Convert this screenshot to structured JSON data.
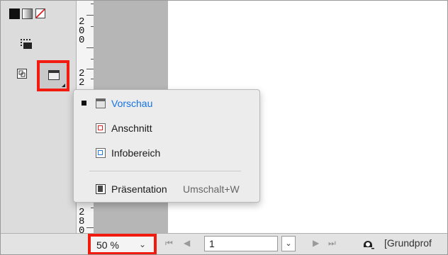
{
  "toolbar": {
    "fill_swatch_icon": "fill-black-swatch",
    "gradient_icon": "gradient-swatch",
    "none_icon": "none-swatch",
    "frame_tool_icon": "dotted-frame-tool",
    "normal_mode_icon": "normal-view-mode",
    "screen_mode_icon": "preview-screen-mode"
  },
  "ruler": {
    "labels": [
      "2",
      "0",
      "0",
      "2",
      "2",
      "2",
      "8",
      "0"
    ]
  },
  "menu": {
    "items": [
      {
        "label": "Vorschau",
        "shortcut": "",
        "checked": true,
        "icon": "vorschau-mode-icon",
        "color": "#1473e6"
      },
      {
        "label": "Anschnitt",
        "shortcut": "",
        "checked": false,
        "icon": "anschnitt-mode-icon",
        "color": "#1a1a1a"
      },
      {
        "label": "Infobereich",
        "shortcut": "",
        "checked": false,
        "icon": "infobereich-mode-icon",
        "color": "#1a1a1a"
      },
      {
        "label": "Präsentation",
        "shortcut": "Umschalt+W",
        "checked": false,
        "icon": "praesentation-mode-icon",
        "color": "#1a1a1a"
      }
    ]
  },
  "statusbar": {
    "zoom": "50 %",
    "page": "1",
    "first_icon": "⏮",
    "prev_icon": "◀",
    "next_icon": "▶",
    "last_icon": "⏭",
    "dropdown_icon": "⌄",
    "profile": "[Grundprof"
  },
  "colors": {
    "highlight": "#f21b0f",
    "accent": "#1473e6"
  }
}
